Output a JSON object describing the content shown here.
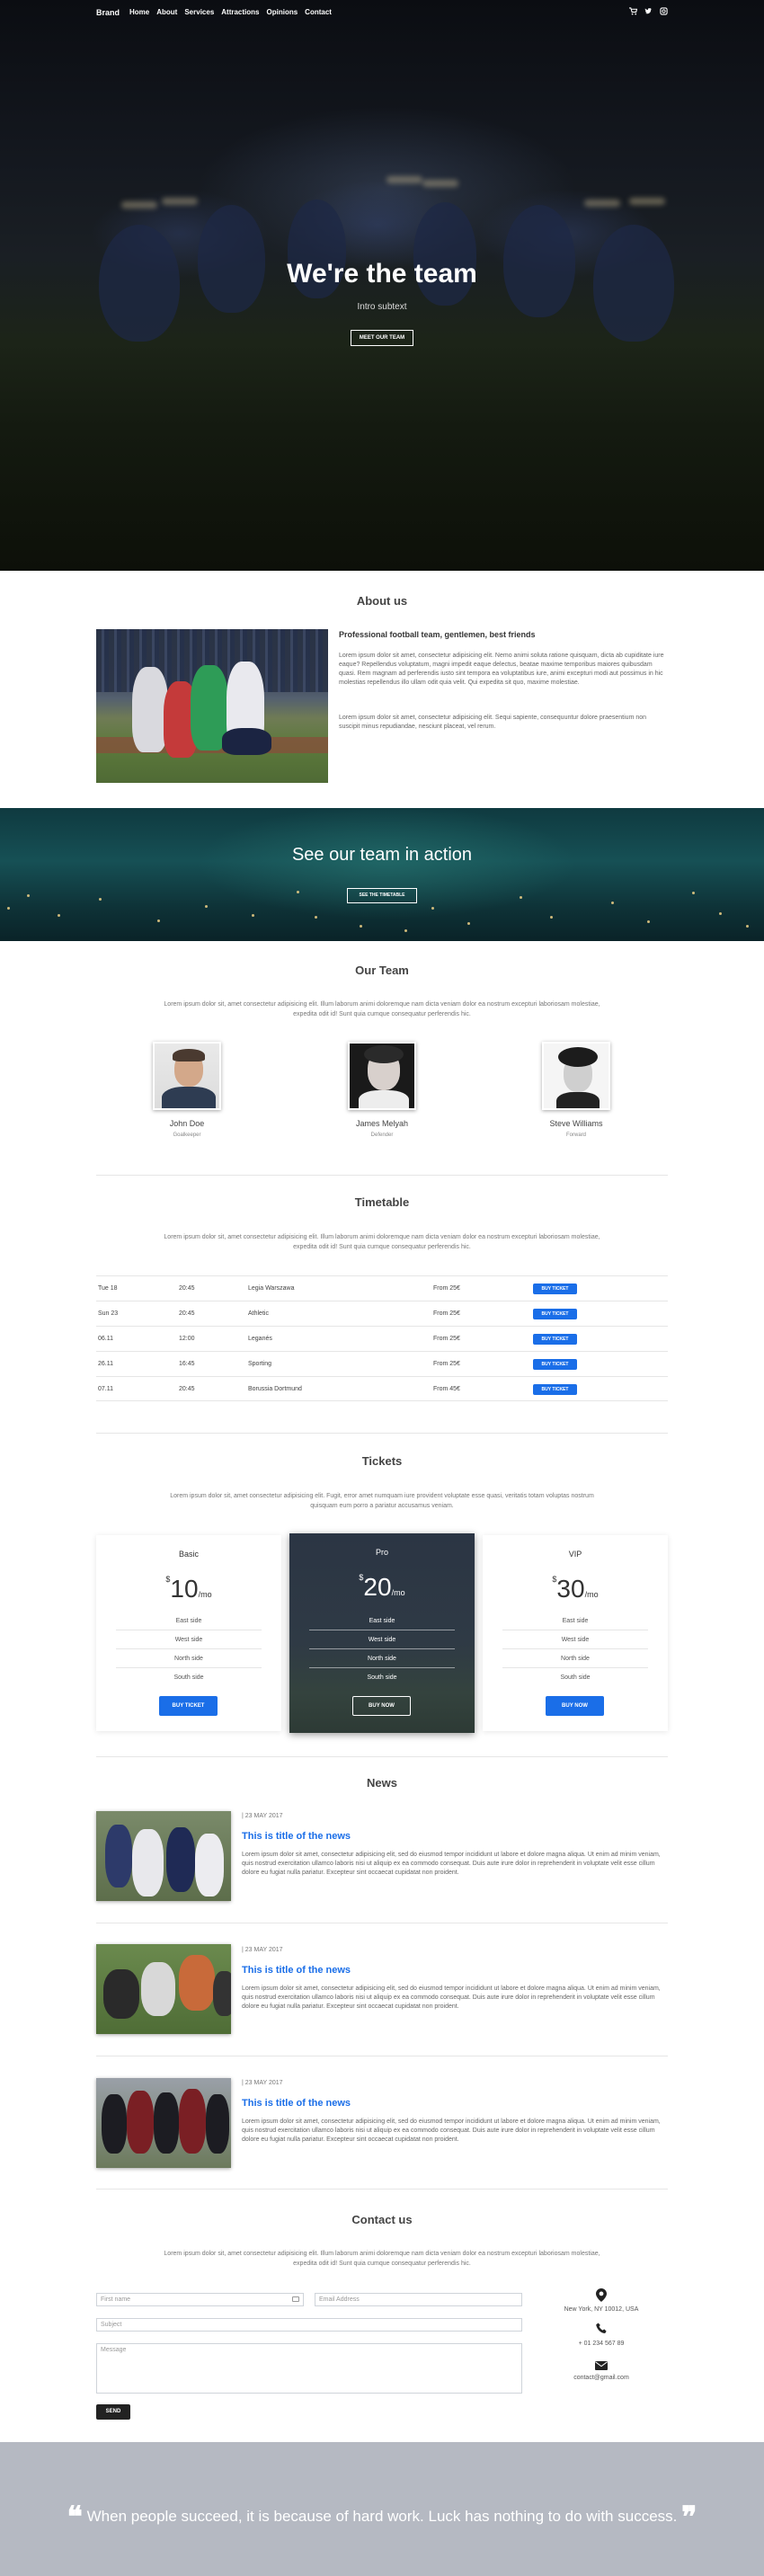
{
  "nav": {
    "brand": "Brand",
    "links": [
      "Home",
      "About",
      "Services",
      "Attractions",
      "Opinions",
      "Contact"
    ],
    "icons": [
      "cart-icon",
      "twitter-icon",
      "instagram-icon"
    ]
  },
  "hero": {
    "title": "We're the team",
    "subtitle": "Intro subtext",
    "button": "MEET OUR TEAM"
  },
  "about": {
    "title": "About us",
    "heading": "Professional football team, gentlemen, best friends",
    "p1": "Lorem ipsum dolor sit amet, consectetur adipisicing elit. Nemo animi soluta ratione quisquam, dicta ab cupiditate iure eaque? Repellendus voluptatum, magni impedit eaque delectus, beatae maxime temporibus maiores quibusdam quasi. Rem magnam ad perferendis iusto sint tempora ea voluptatibus iure, animi excepturi modi aut possimus in hic molestias repellendus illo ullam odit quia velit. Qui expedita sit quo, maxime molestiae.",
    "p2": "Lorem ipsum dolor sit amet, consectetur adipisicing elit. Sequi sapiente, consequuntur dolore praesentium non suscipit minus repudiandae, nesciunt placeat, vel rerum."
  },
  "action": {
    "title": "See our team in action",
    "button": "SEE THE TIMETABLE"
  },
  "team": {
    "title": "Our Team",
    "description": "Lorem ipsum dolor sit, amet consectetur adipisicing elit. Illum laborum animi doloremque nam dicta veniam dolor ea nostrum excepturi laboriosam molestiae, expedita odit id! Sunt quia cumque consequatur perferendis hic.",
    "members": [
      {
        "name": "John Doe",
        "role": "Goalkeeper"
      },
      {
        "name": "James Melyah",
        "role": "Defender"
      },
      {
        "name": "Steve Williams",
        "role": "Forward"
      }
    ]
  },
  "timetable": {
    "title": "Timetable",
    "description": "Lorem ipsum dolor sit, amet consectetur adipisicing elit. Illum laborum animi doloremque nam dicta veniam dolor ea nostrum excepturi laboriosam molestiae, expedita odit id! Sunt quia cumque consequatur perferendis hic.",
    "rows": [
      {
        "date": "Tue 18",
        "time": "20:45",
        "opponent": "Legia Warszawa",
        "price": "From 25€",
        "button": "BUY TICKET"
      },
      {
        "date": "Sun 23",
        "time": "20:45",
        "opponent": "Athletic",
        "price": "From 25€",
        "button": "BUY TICKET"
      },
      {
        "date": "06.11",
        "time": "12:00",
        "opponent": "Leganés",
        "price": "From 25€",
        "button": "BUY TICKET"
      },
      {
        "date": "26.11",
        "time": "16:45",
        "opponent": "Sporting",
        "price": "From 25€",
        "button": "BUY TICKET"
      },
      {
        "date": "07.11",
        "time": "20:45",
        "opponent": "Borussia Dortmund",
        "price": "From 45€",
        "button": "BUY TICKET"
      }
    ]
  },
  "tickets": {
    "title": "Tickets",
    "description": "Lorem ipsum dolor sit, amet consectetur adipisicing elit. Fugit, error amet numquam iure provident voluptate esse quasi, veritatis totam voluptas nostrum quisquam eum porro a pariatur accusamus veniam.",
    "plans": [
      {
        "name": "Basic",
        "currency": "$",
        "amount": "10",
        "period": "/mo",
        "features": [
          "East side",
          "West side",
          "North side",
          "South side"
        ],
        "button": "BUY TICKET"
      },
      {
        "name": "Pro",
        "currency": "$",
        "amount": "20",
        "period": "/mo",
        "features": [
          "East side",
          "West side",
          "North side",
          "South side"
        ],
        "button": "BUY NOW"
      },
      {
        "name": "VIP",
        "currency": "$",
        "amount": "30",
        "period": "/mo",
        "features": [
          "East side",
          "West side",
          "North side",
          "South side"
        ],
        "button": "BUY NOW"
      }
    ]
  },
  "news": {
    "title": "News",
    "items": [
      {
        "date": "| 23 MAY 2017",
        "headline": "This is title of the news",
        "body": "Lorem ipsum dolor sit amet, consectetur adipisicing elit, sed do eiusmod tempor incididunt ut labore et dolore magna aliqua. Ut enim ad minim veniam, quis nostrud exercitation ullamco laboris nisi ut aliquip ex ea commodo consequat. Duis aute irure dolor in reprehenderit in voluptate velit esse cillum dolore eu fugiat nulla pariatur. Excepteur sint occaecat cupidatat non proident."
      },
      {
        "date": "| 23 MAY 2017",
        "headline": "This is title of the news",
        "body": "Lorem ipsum dolor sit amet, consectetur adipisicing elit, sed do eiusmod tempor incididunt ut labore et dolore magna aliqua. Ut enim ad minim veniam, quis nostrud exercitation ullamco laboris nisi ut aliquip ex ea commodo consequat. Duis aute irure dolor in reprehenderit in voluptate velit esse cillum dolore eu fugiat nulla pariatur. Excepteur sint occaecat cupidatat non proident."
      },
      {
        "date": "| 23 MAY 2017",
        "headline": "This is title of the news",
        "body": "Lorem ipsum dolor sit amet, consectetur adipisicing elit, sed do eiusmod tempor incididunt ut labore et dolore magna aliqua. Ut enim ad minim veniam, quis nostrud exercitation ullamco laboris nisi ut aliquip ex ea commodo consequat. Duis aute irure dolor in reprehenderit in voluptate velit esse cillum dolore eu fugiat nulla pariatur. Excepteur sint occaecat cupidatat non proident."
      }
    ]
  },
  "contact": {
    "title": "Contact us",
    "description": "Lorem ipsum dolor sit, amet consectetur adipisicing elit. Illum laborum animi doloremque nam dicta veniam dolor ea nostrum excepturi laboriosam molestiae, expedita odit id! Sunt quia cumque consequatur perferendis hic.",
    "first_name_placeholder": "First name",
    "email_placeholder": "Email Address",
    "subject_placeholder": "Subject",
    "message_placeholder": "Message",
    "send": "SEND",
    "address": "New York, NY 10012, USA",
    "phone": "+ 01 234 567 89",
    "email": "contact@gmail.com"
  },
  "quote": {
    "open": "❝",
    "text": "When people succeed, it is because of hard work. Luck has nothing to do with success.",
    "close": "❞"
  },
  "colors": {
    "accent": "#1a6ee8",
    "quote_bg": "#b5b9c2",
    "dark_card": "#2f3a45"
  }
}
